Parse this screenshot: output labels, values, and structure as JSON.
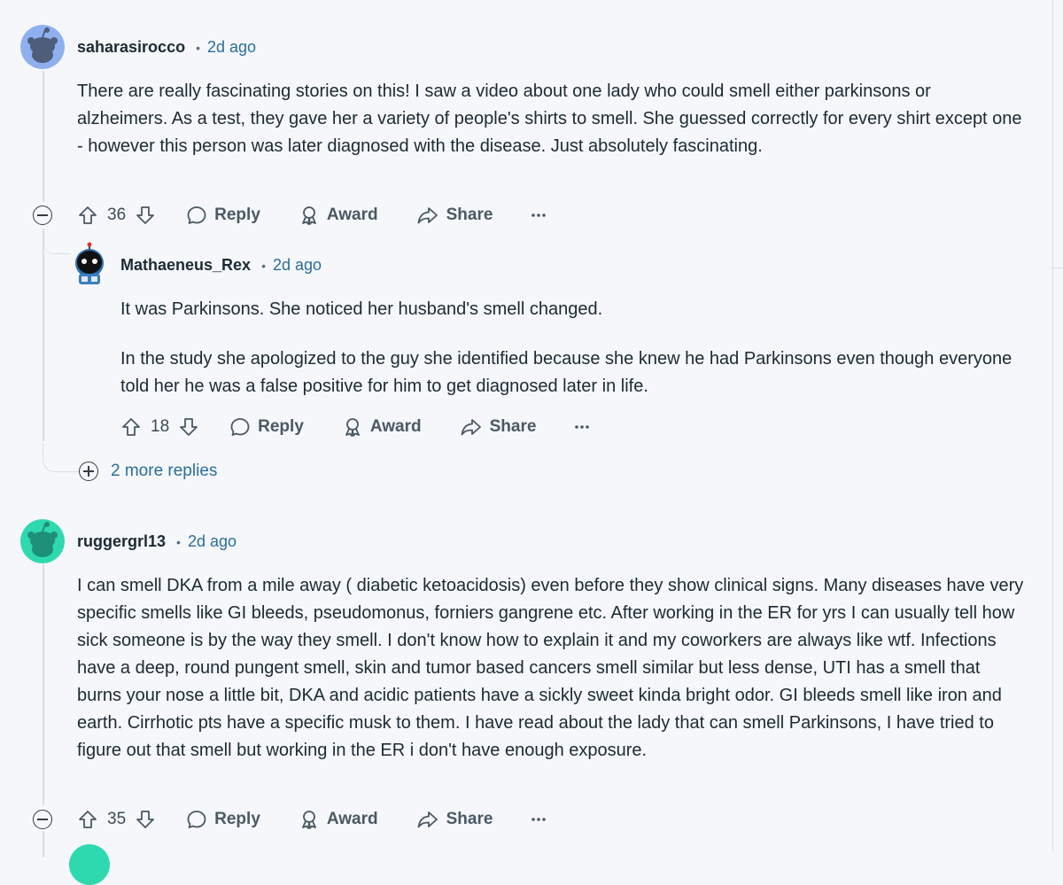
{
  "comments": [
    {
      "username": "saharasirocco",
      "time": "2d ago",
      "body": "There are really fascinating stories on this! I saw a video about one lady who could smell either parkinsons or alzheimers. As a test, they gave her a variety of people's shirts to smell. She guessed correctly for every shirt except one - however this person was later diagnosed with the disease. Just absolutely fascinating.",
      "votes": "36",
      "avatar_color": "#8fb0f0"
    },
    {
      "username": "Mathaeneus_Rex",
      "time": "2d ago",
      "body_p1": "It was Parkinsons. She noticed her husband's smell changed.",
      "body_p2": "In the study she apologized to the guy she identified because she knew he had Parkinsons even though everyone told her he was a false positive for him to get diagnosed later in life.",
      "votes": "18"
    },
    {
      "username": "ruggergrl13",
      "time": "2d ago",
      "body": "I can smell DKA from a mile away ( diabetic ketoacidosis) even before they show clinical signs. Many diseases have very specific smells like GI bleeds, pseudomonus, forniers gangrene etc. After working in the ER for yrs I can usually tell how sick someone is by the way they smell. I don't know how to explain it and my coworkers are always like wtf. Infections have a deep, round pungent smell, skin and tumor based cancers smell similar but less dense, UTI has a smell that burns your nose a little bit, DKA and acidic patients have a sickly sweet kinda bright odor. GI bleeds smell like iron and earth. Cirrhotic pts have a specific musk to them. I have read about the lady that can smell Parkinsons, I have tried to figure out that smell but working in the ER i don't have enough exposure.",
      "votes": "35",
      "avatar_color": "#2fd9b0"
    }
  ],
  "actions": {
    "reply": "Reply",
    "award": "Award",
    "share": "Share"
  },
  "more_replies": "2 more replies",
  "icons": {
    "upvote": "arrow-up-icon",
    "downvote": "arrow-down-icon",
    "reply": "speech-bubble-icon",
    "award": "award-icon",
    "share": "share-arrow-icon",
    "overflow": "ellipsis-icon",
    "collapse": "minus-circle-icon",
    "expand": "plus-circle-icon"
  },
  "colors": {
    "background": "#f5f7fa",
    "link": "#2a6e9a",
    "text": "#1c2a33"
  }
}
